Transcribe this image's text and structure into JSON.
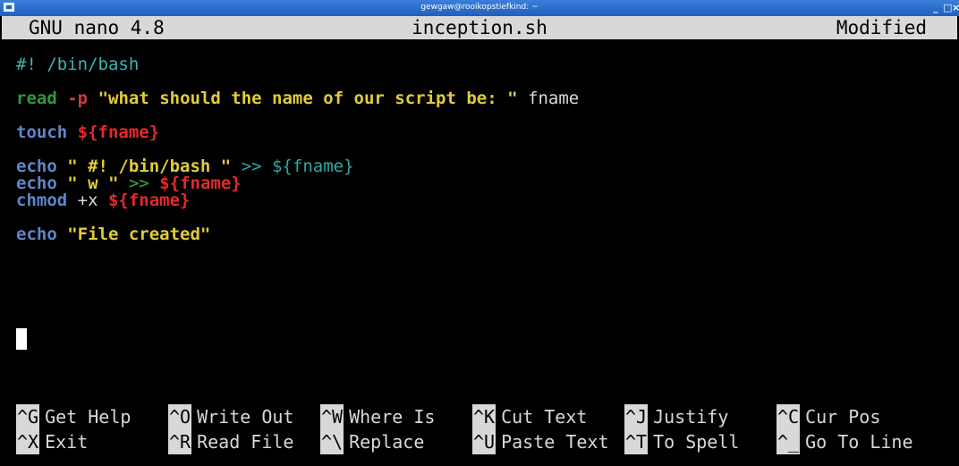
{
  "window": {
    "title": "gewgaw@rooikopstiefkind: ~",
    "buttons": {
      "minimize": "_",
      "maximize": "□",
      "close": "×"
    }
  },
  "nano": {
    "version": "GNU nano 4.8",
    "filename": "inception.sh",
    "status": "Modified"
  },
  "code": {
    "shebang": "#! /bin/bash",
    "read_cmd": "read",
    "read_flag": "-p",
    "read_prompt": "\"what should the name of our script be: \"",
    "read_var": " fname",
    "touch_cmd": "touch",
    "touch_arg": "${fname}",
    "echo1_cmd": "echo",
    "echo1_str": "\" #! /bin/bash \"",
    "echo1_op": " >>",
    "echo1_var": "${fname}",
    "echo2_cmd": "echo",
    "echo2_str": "\" w \"",
    "echo2_op": " >>",
    "echo2_var": "${fname}",
    "chmod_cmd": "chmod",
    "chmod_args": " +x",
    "chmod_var": "${fname}",
    "echo3_cmd": "echo",
    "echo3_str": "\"File created\""
  },
  "shortcuts": [
    {
      "key": "^G",
      "label": "Get Help"
    },
    {
      "key": "^O",
      "label": "Write Out"
    },
    {
      "key": "^W",
      "label": "Where Is"
    },
    {
      "key": "^K",
      "label": "Cut Text"
    },
    {
      "key": "^J",
      "label": "Justify"
    },
    {
      "key": "^C",
      "label": "Cur Pos"
    },
    {
      "key": "^X",
      "label": "Exit"
    },
    {
      "key": "^R",
      "label": "Read File"
    },
    {
      "key": "^\\",
      "label": "Replace"
    },
    {
      "key": "^U",
      "label": "Paste Text"
    },
    {
      "key": "^T",
      "label": "To Spell"
    },
    {
      "key": "^_",
      "label": "Go To Line"
    }
  ],
  "colors": {
    "titlebar": "#2b6fd0",
    "header_bg": "#d8d8d8",
    "keyword_blue": "#5f86c8",
    "string_yellow": "#e0cc3a",
    "variable_red": "#e22a2a",
    "comment_cyan": "#3ab5b5"
  }
}
